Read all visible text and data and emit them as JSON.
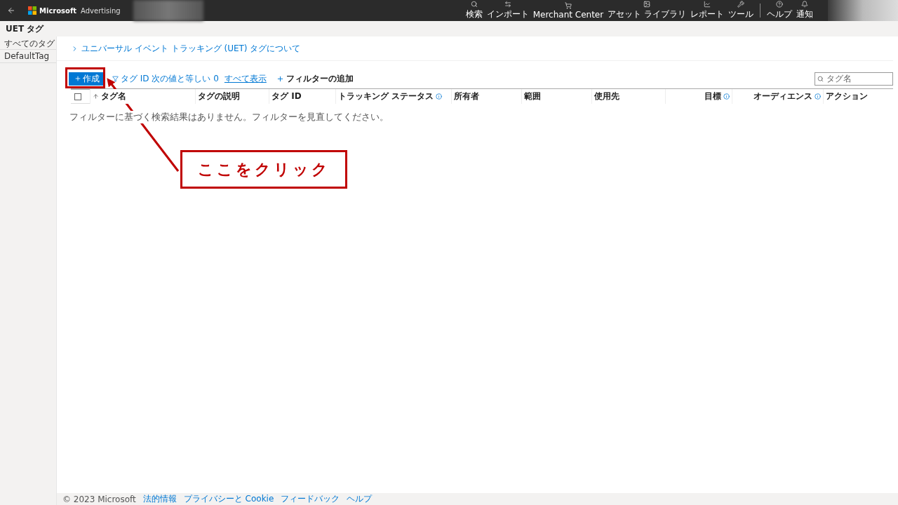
{
  "top_bar": {
    "brand": "Microsoft",
    "product": "Advertising",
    "nav": [
      {
        "kind": "search",
        "label": "検索"
      },
      {
        "kind": "import",
        "label": "インポート"
      },
      {
        "kind": "cart",
        "label": "Merchant Center"
      },
      {
        "kind": "image",
        "label": "アセット ライブラリ"
      },
      {
        "kind": "chart",
        "label": "レポート"
      },
      {
        "kind": "tools",
        "label": "ツール"
      },
      {
        "kind": "help",
        "label": "ヘルプ"
      },
      {
        "kind": "bell",
        "label": "通知"
      }
    ]
  },
  "page_title": "UET タグ",
  "sidebar": {
    "items": [
      {
        "label": "すべてのタグ",
        "selected": false
      },
      {
        "label": "DefaultTag",
        "selected": false
      }
    ]
  },
  "info_link": "ユニバーサル イベント トラッキング (UET) タグについて",
  "toolbar": {
    "create": "作成",
    "filter": "タグ ID 次の値と等しい 0",
    "show_all": "すべて表示",
    "add_filter": "フィルターの追加",
    "search_placeholder": "タグ名"
  },
  "table": {
    "all_checked": false,
    "columns": [
      {
        "label": "タグ名",
        "sorted": true,
        "info": false
      },
      {
        "label": "タグの説明",
        "sorted": false,
        "info": false
      },
      {
        "label": "タグ ID",
        "sorted": false,
        "info": false
      },
      {
        "label": "トラッキング ステータス",
        "sorted": false,
        "info": true
      },
      {
        "label": "所有者",
        "sorted": false,
        "info": false
      },
      {
        "label": "範囲",
        "sorted": false,
        "info": false
      },
      {
        "label": "使用先",
        "sorted": false,
        "info": false
      },
      {
        "label": "目標",
        "sorted": false,
        "info": true
      },
      {
        "label": "オーディエンス",
        "sorted": false,
        "info": true
      },
      {
        "label": "アクション",
        "sorted": false,
        "info": false
      }
    ],
    "empty_message": "フィルターに基づく検索結果はありません。フィルターを見直してください。"
  },
  "footer": [
    "© 2023 Microsoft",
    "法的情報",
    "プライバシーと Cookie",
    "フィードバック",
    "ヘルプ"
  ],
  "annotation": {
    "text": "ここをクリック"
  }
}
